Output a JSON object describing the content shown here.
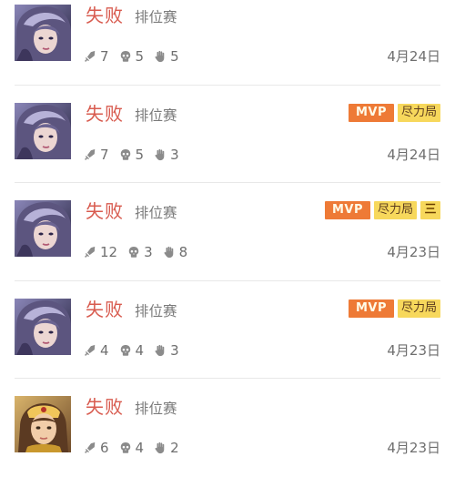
{
  "colors": {
    "defeat": "#d85b4f",
    "mvp_badge": "#ee7a36",
    "effort_badge": "#f7d85c",
    "divider": "#e8e8e8"
  },
  "icons": {
    "kills": "sword-icon",
    "deaths": "skull-icon",
    "assists": "hand-icon"
  },
  "matches": [
    {
      "result": "失败",
      "mode": "排位赛",
      "kills": "7",
      "deaths": "5",
      "assists": "5",
      "date": "4月24日",
      "badges": [],
      "hero": "violet-hair"
    },
    {
      "result": "失败",
      "mode": "排位赛",
      "kills": "7",
      "deaths": "5",
      "assists": "3",
      "date": "4月24日",
      "badges": [
        "MVP",
        "尽力局"
      ],
      "hero": "violet-hair"
    },
    {
      "result": "失败",
      "mode": "排位赛",
      "kills": "12",
      "deaths": "3",
      "assists": "8",
      "date": "4月23日",
      "badges": [
        "MVP",
        "尽力局",
        "三"
      ],
      "hero": "violet-hair"
    },
    {
      "result": "失败",
      "mode": "排位赛",
      "kills": "4",
      "deaths": "4",
      "assists": "3",
      "date": "4月23日",
      "badges": [
        "MVP",
        "尽力局"
      ],
      "hero": "violet-hair"
    },
    {
      "result": "失败",
      "mode": "排位赛",
      "kills": "6",
      "deaths": "4",
      "assists": "2",
      "date": "4月23日",
      "badges": [],
      "hero": "golden-crown"
    }
  ]
}
